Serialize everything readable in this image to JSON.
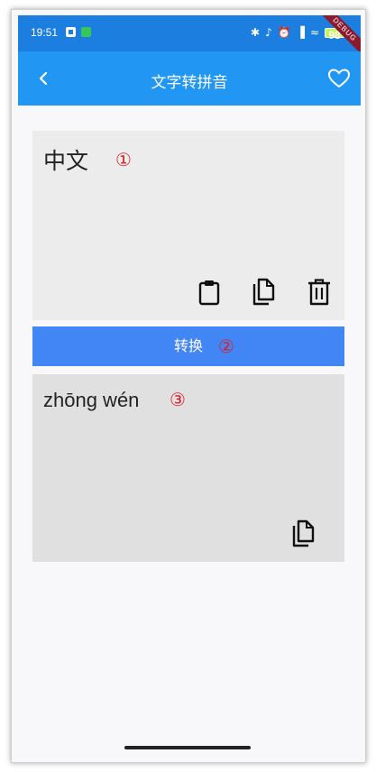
{
  "status_bar": {
    "time": "19:51",
    "battery": "98"
  },
  "debug_banner": "DEBUG",
  "app_bar": {
    "title": "文字转拼音"
  },
  "input": {
    "text": "中文",
    "marker": "①"
  },
  "convert_button": {
    "label": "转换",
    "marker": "②"
  },
  "output": {
    "text": "zhōng wén",
    "marker": "③"
  },
  "colors": {
    "app_bar": "#2196f3",
    "status_bar": "#1c7fe0",
    "button": "#4286f5",
    "marker": "#d8212b"
  },
  "icons": {
    "back": "back-arrow-icon",
    "favorite": "heart-outline-icon",
    "paste": "clipboard-icon",
    "copy": "copy-icon",
    "delete": "trash-icon"
  }
}
